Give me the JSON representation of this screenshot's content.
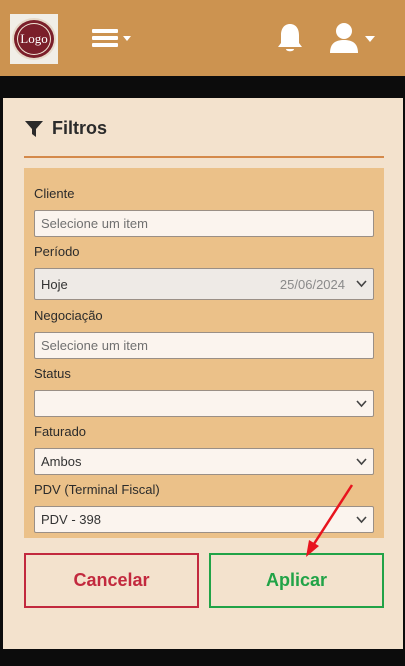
{
  "header": {
    "logo_text": "Logo",
    "menu_icon": "hamburger-menu-icon",
    "notification_icon": "bell-icon",
    "user_icon": "user-icon"
  },
  "filters": {
    "title": "Filtros",
    "icon": "filter-icon",
    "fields": {
      "cliente": {
        "label": "Cliente",
        "placeholder": "Selecione um item"
      },
      "periodo": {
        "label": "Período",
        "value": "Hoje",
        "date": "25/06/2024"
      },
      "negociacao": {
        "label": "Negociação",
        "placeholder": "Selecione um item"
      },
      "status": {
        "label": "Status",
        "value": ""
      },
      "faturado": {
        "label": "Faturado",
        "value": "Ambos"
      },
      "pdv": {
        "label": "PDV (Terminal Fiscal)",
        "value": "PDV - 398"
      }
    },
    "buttons": {
      "cancel": "Cancelar",
      "apply": "Aplicar"
    }
  },
  "colors": {
    "topbar": "#cc9350",
    "panel": "#f3e2cd",
    "form_area": "#ebc189",
    "cancel": "#c2293e",
    "apply": "#21a347",
    "annotation_arrow": "#e8141e"
  }
}
